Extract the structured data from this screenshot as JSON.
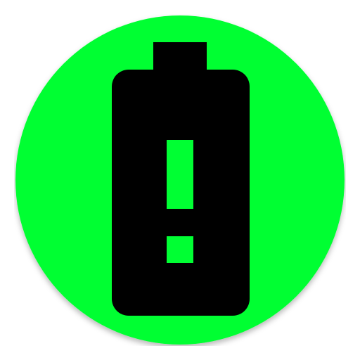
{
  "icon": {
    "name": "battery-alert-icon",
    "background_color": "#00FF33",
    "glyph_color": "#000000"
  }
}
